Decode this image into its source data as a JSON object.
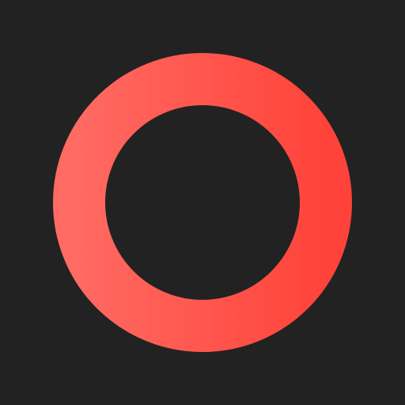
{
  "icon": {
    "name": "ring-icon",
    "background_color": "#222222",
    "ring_gradient_start": "#FF6A62",
    "ring_gradient_end": "#FF433A"
  }
}
